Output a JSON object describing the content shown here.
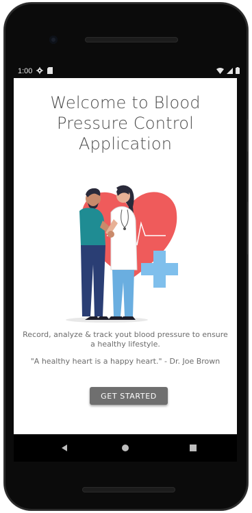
{
  "status_bar": {
    "time": "1:00",
    "icons": [
      "gear-icon",
      "sim-card-icon",
      "wifi-icon",
      "signal-icon",
      "battery-icon"
    ]
  },
  "welcome": {
    "title": "Welcome to Blood Pressure Control Application",
    "description": "Record, analyze & track yout blood pressure to ensure a healthy lifestyle.",
    "quote": "\"A healthy heart is a happy heart.\" - Dr. Joe Brown",
    "button_label": "GET STARTED"
  },
  "nav_bar": {
    "icons": [
      "back-icon",
      "home-icon",
      "recents-icon"
    ]
  },
  "colors": {
    "heart": "#ef5b5b",
    "cross": "#7fbfec",
    "button": "#6f6f6f",
    "title": "#4b4b4b"
  }
}
